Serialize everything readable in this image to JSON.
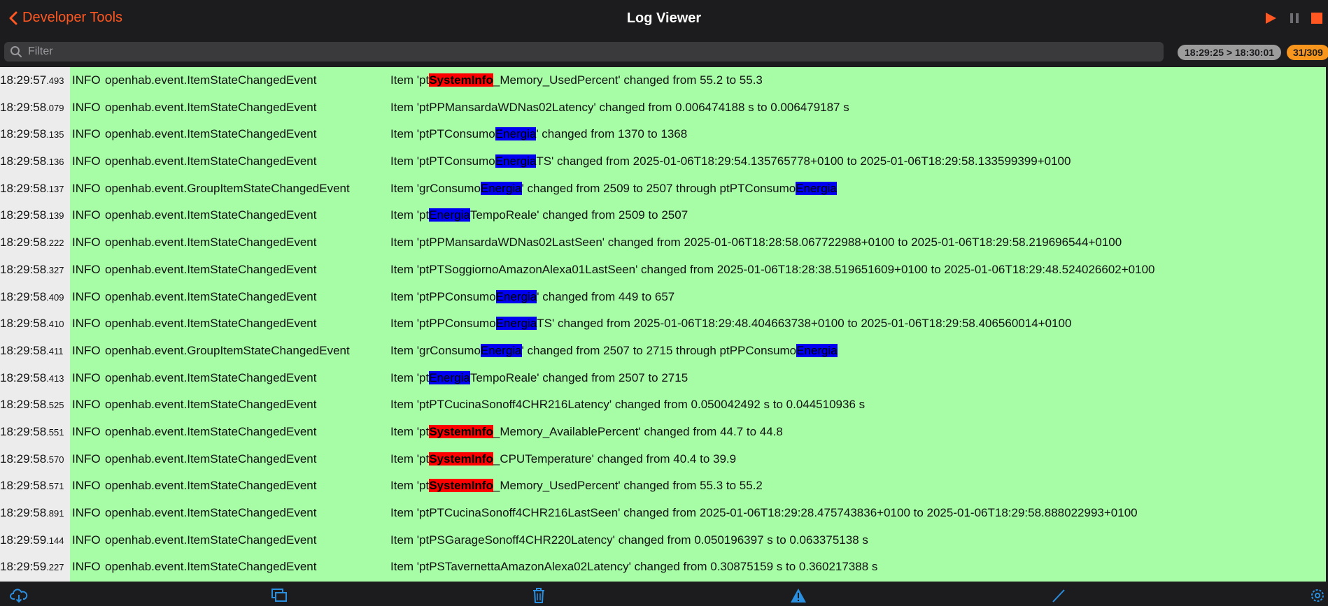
{
  "nav": {
    "back_label": "Developer Tools",
    "title": "Log Viewer",
    "play_icon": "play-icon",
    "pause_icon": "pause-icon",
    "stop_icon": "stop-icon",
    "accent": "#ff5722"
  },
  "filter": {
    "placeholder": "Filter",
    "value": "",
    "time_range": "18:29:25 > 18:30:01",
    "count": "31/309"
  },
  "log": {
    "rows": [
      {
        "time": "18:29:57",
        "ms": ".493",
        "level": "INFO",
        "source": "openhab.event.ItemStateChangedEvent",
        "parts": [
          [
            "Item 'pt",
            ""
          ],
          [
            "SystemInfo",
            "red"
          ],
          [
            "_Memory_UsedPercent' changed from 55.2 to 55.3",
            ""
          ]
        ]
      },
      {
        "time": "18:29:58",
        "ms": ".079",
        "level": "INFO",
        "source": "openhab.event.ItemStateChangedEvent",
        "parts": [
          [
            "Item 'ptPPMansardaWDNas02Latency' changed from 0.006474188 s to 0.006479187 s",
            ""
          ]
        ]
      },
      {
        "time": "18:29:58",
        "ms": ".135",
        "level": "INFO",
        "source": "openhab.event.ItemStateChangedEvent",
        "parts": [
          [
            "Item 'ptPTConsumo",
            ""
          ],
          [
            "Energia",
            "blue"
          ],
          [
            "' changed from 1370 to 1368",
            ""
          ]
        ]
      },
      {
        "time": "18:29:58",
        "ms": ".136",
        "level": "INFO",
        "source": "openhab.event.ItemStateChangedEvent",
        "parts": [
          [
            "Item 'ptPTConsumo",
            ""
          ],
          [
            "Energia",
            "blue"
          ],
          [
            "TS' changed from 2025-01-06T18:29:54.135765778+0100 to 2025-01-06T18:29:58.133599399+0100",
            ""
          ]
        ]
      },
      {
        "time": "18:29:58",
        "ms": ".137",
        "level": "INFO",
        "source": "openhab.event.GroupItemStateChangedEvent",
        "parts": [
          [
            "Item 'grConsumo",
            ""
          ],
          [
            "Energia",
            "blue"
          ],
          [
            "' changed from 2509 to 2507 through ptPTConsumo",
            ""
          ],
          [
            "Energia",
            "blue"
          ]
        ]
      },
      {
        "time": "18:29:58",
        "ms": ".139",
        "level": "INFO",
        "source": "openhab.event.ItemStateChangedEvent",
        "parts": [
          [
            "Item 'pt",
            ""
          ],
          [
            "Energia",
            "blue"
          ],
          [
            "TempoReale' changed from 2509 to 2507",
            ""
          ]
        ]
      },
      {
        "time": "18:29:58",
        "ms": ".222",
        "level": "INFO",
        "source": "openhab.event.ItemStateChangedEvent",
        "parts": [
          [
            "Item 'ptPPMansardaWDNas02LastSeen' changed from 2025-01-06T18:28:58.067722988+0100 to 2025-01-06T18:29:58.219696544+0100",
            ""
          ]
        ]
      },
      {
        "time": "18:29:58",
        "ms": ".327",
        "level": "INFO",
        "source": "openhab.event.ItemStateChangedEvent",
        "parts": [
          [
            "Item 'ptPTSoggiornoAmazonAlexa01LastSeen' changed from 2025-01-06T18:28:38.519651609+0100 to 2025-01-06T18:29:48.524026602+0100",
            ""
          ]
        ]
      },
      {
        "time": "18:29:58",
        "ms": ".409",
        "level": "INFO",
        "source": "openhab.event.ItemStateChangedEvent",
        "parts": [
          [
            "Item 'ptPPConsumo",
            ""
          ],
          [
            "Energia",
            "blue"
          ],
          [
            "' changed from 449 to 657",
            ""
          ]
        ]
      },
      {
        "time": "18:29:58",
        "ms": ".410",
        "level": "INFO",
        "source": "openhab.event.ItemStateChangedEvent",
        "parts": [
          [
            "Item 'ptPPConsumo",
            ""
          ],
          [
            "Energia",
            "blue"
          ],
          [
            "TS' changed from 2025-01-06T18:29:48.404663738+0100 to 2025-01-06T18:29:58.406560014+0100",
            ""
          ]
        ]
      },
      {
        "time": "18:29:58",
        "ms": ".411",
        "level": "INFO",
        "source": "openhab.event.GroupItemStateChangedEvent",
        "parts": [
          [
            "Item 'grConsumo",
            ""
          ],
          [
            "Energia",
            "blue"
          ],
          [
            "' changed from 2507 to 2715 through ptPPConsumo",
            ""
          ],
          [
            "Energia",
            "blue"
          ]
        ]
      },
      {
        "time": "18:29:58",
        "ms": ".413",
        "level": "INFO",
        "source": "openhab.event.ItemStateChangedEvent",
        "parts": [
          [
            "Item 'pt",
            ""
          ],
          [
            "Energia",
            "blue"
          ],
          [
            "TempoReale' changed from 2507 to 2715",
            ""
          ]
        ]
      },
      {
        "time": "18:29:58",
        "ms": ".525",
        "level": "INFO",
        "source": "openhab.event.ItemStateChangedEvent",
        "parts": [
          [
            "Item 'ptPTCucinaSonoff4CHR216Latency' changed from 0.050042492 s to 0.044510936 s",
            ""
          ]
        ]
      },
      {
        "time": "18:29:58",
        "ms": ".551",
        "level": "INFO",
        "source": "openhab.event.ItemStateChangedEvent",
        "parts": [
          [
            "Item 'pt",
            ""
          ],
          [
            "SystemInfo",
            "red"
          ],
          [
            "_Memory_AvailablePercent' changed from 44.7 to 44.8",
            ""
          ]
        ]
      },
      {
        "time": "18:29:58",
        "ms": ".570",
        "level": "INFO",
        "source": "openhab.event.ItemStateChangedEvent",
        "parts": [
          [
            "Item 'pt",
            ""
          ],
          [
            "SystemInfo",
            "red"
          ],
          [
            "_CPUTemperature' changed from 40.4 to 39.9",
            ""
          ]
        ]
      },
      {
        "time": "18:29:58",
        "ms": ".571",
        "level": "INFO",
        "source": "openhab.event.ItemStateChangedEvent",
        "parts": [
          [
            "Item 'pt",
            ""
          ],
          [
            "SystemInfo",
            "red"
          ],
          [
            "_Memory_UsedPercent' changed from 55.3 to 55.2",
            ""
          ]
        ]
      },
      {
        "time": "18:29:58",
        "ms": ".891",
        "level": "INFO",
        "source": "openhab.event.ItemStateChangedEvent",
        "parts": [
          [
            "Item 'ptPTCucinaSonoff4CHR216LastSeen' changed from 2025-01-06T18:29:28.475743836+0100 to 2025-01-06T18:29:58.888022993+0100",
            ""
          ]
        ]
      },
      {
        "time": "18:29:59",
        "ms": ".144",
        "level": "INFO",
        "source": "openhab.event.ItemStateChangedEvent",
        "parts": [
          [
            "Item 'ptPSGarageSonoff4CHR220Latency' changed from 0.050196397 s to 0.063375138 s",
            ""
          ]
        ]
      },
      {
        "time": "18:29:59",
        "ms": ".227",
        "level": "INFO",
        "source": "openhab.event.ItemStateChangedEvent",
        "parts": [
          [
            "Item 'ptPSTavernettaAmazonAlexa02Latency' changed from 0.30875159 s to 0.360217388 s",
            ""
          ]
        ]
      }
    ],
    "highlight_colors": {
      "red": "#ff0000",
      "blue": "#0000f0"
    },
    "row_background": "#a6fda6"
  },
  "toolbar": {
    "items": [
      "cloud-download-icon",
      "copy-icon",
      "trash-icon",
      "warning-icon",
      "pencil-icon",
      "settings-icon"
    ],
    "icon_color": "#2b8fe0"
  }
}
